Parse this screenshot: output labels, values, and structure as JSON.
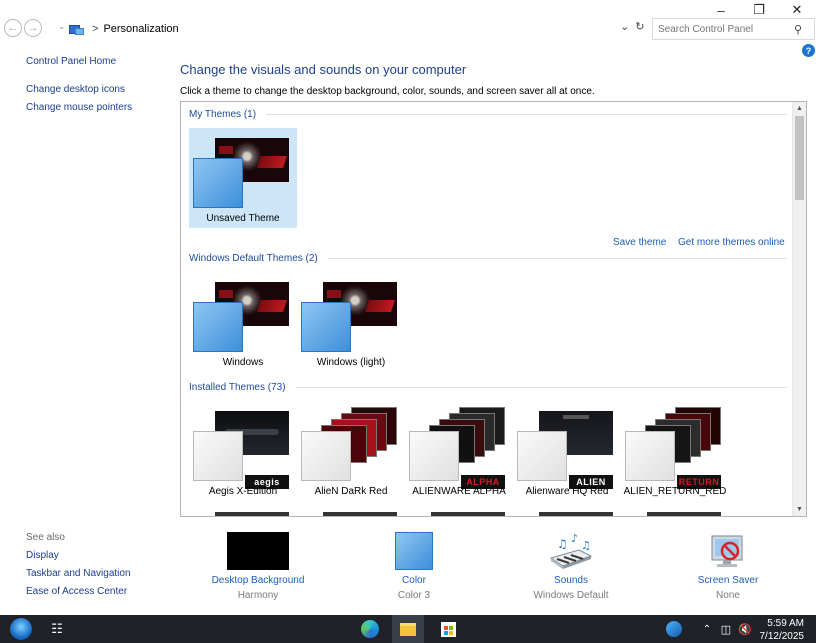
{
  "window": {
    "minimize": "–",
    "maximize": "❐",
    "close": "✕"
  },
  "address": {
    "breadcrumb": "Personalization",
    "search_placeholder": "Search Control Panel"
  },
  "leftnav": {
    "items": [
      "Control Panel Home",
      "Change desktop icons",
      "Change mouse pointers"
    ]
  },
  "seealso": {
    "header": "See also",
    "items": [
      "Display",
      "Taskbar and Navigation",
      "Ease of Access Center"
    ]
  },
  "main": {
    "heading": "Change the visuals and sounds on your computer",
    "subheading": "Click a theme to change the desktop background, color, sounds, and screen saver all at once."
  },
  "groups": {
    "my_themes": {
      "title": "My Themes (1)",
      "items": [
        "Unsaved Theme"
      ]
    },
    "default_themes": {
      "title": "Windows Default Themes (2)",
      "items": [
        "Windows",
        "Windows (light)"
      ]
    },
    "installed_themes": {
      "title": "Installed Themes (73)",
      "items": [
        "Aegis X-Edition",
        "AlieN DaRk Red",
        "ALIENWARE ALPHA",
        "Alienware HQ Red",
        "ALIEN_RETURN_RED"
      ],
      "logos": [
        "aegis",
        "",
        "ALPHA",
        "ALIEN",
        "RETURN"
      ]
    }
  },
  "links": {
    "save_theme": "Save theme",
    "get_more": "Get more themes online"
  },
  "settings": [
    {
      "label": "Desktop Background",
      "sub": "Harmony"
    },
    {
      "label": "Color",
      "sub": "Color 3"
    },
    {
      "label": "Sounds",
      "sub": "Windows Default"
    },
    {
      "label": "Screen Saver",
      "sub": "None"
    }
  ],
  "taskbar": {
    "time": "5:59 AM",
    "date": "7/12/2025"
  },
  "colors": {
    "accent": "#1a5db8",
    "heading": "#1e3e8c",
    "selected": "#cde6f7",
    "taskbar": "#1f2228"
  }
}
